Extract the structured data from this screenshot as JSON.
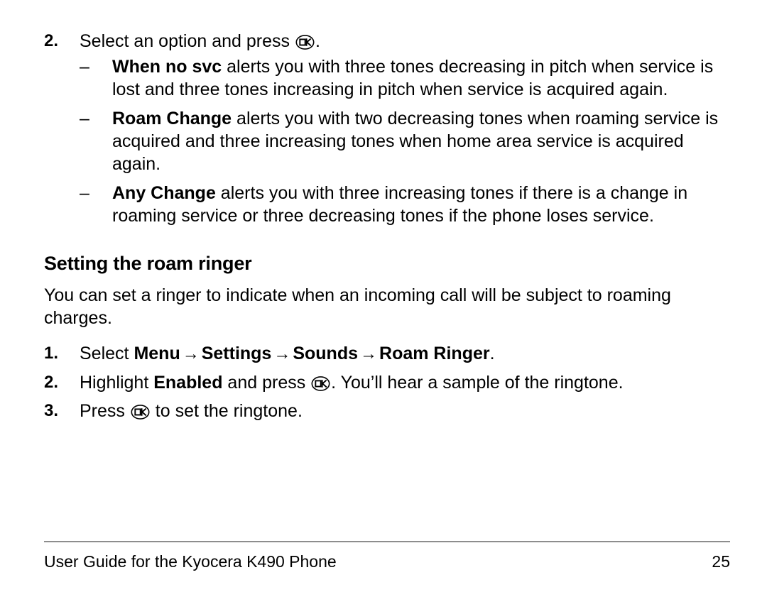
{
  "page": {
    "number": "25",
    "icons": {
      "ok_key": "ok-key-icon"
    },
    "arrow_glyph": "→"
  },
  "top_step": {
    "number": "2.",
    "text_before_icon": "Select an option and press ",
    "text_after_icon": "."
  },
  "sub_bullets": {
    "dash": "–",
    "items": [
      {
        "term": "When no svc",
        "text": " alerts you with three tones decreasing in pitch when service is lost and three tones increasing in pitch when service is acquired again."
      },
      {
        "term": "Roam Change",
        "text": " alerts you with two decreasing tones when roaming service is acquired and three increasing tones when home area service is acquired again."
      },
      {
        "term": "Any Change",
        "text": " alerts you with three increasing tones if there is a change in roaming service or three decreasing tones if the phone loses service."
      }
    ]
  },
  "section": {
    "heading": "Setting the roam ringer",
    "paragraph": "You can set a ringer to indicate when an incoming call will be subject to roaming charges."
  },
  "steps": {
    "step1": {
      "number": "1.",
      "lead": "Select ",
      "menu_path": [
        "Menu",
        "Settings",
        "Sounds",
        "Roam Ringer"
      ],
      "trailing": "."
    },
    "step2": {
      "number": "2.",
      "lead": "Highlight ",
      "bold": "Enabled",
      "mid": " and press ",
      "tail": ". You’ll hear a sample of the ringtone."
    },
    "step3": {
      "number": "3.",
      "lead": "Press ",
      "tail": " to set the ringtone."
    }
  },
  "footer": {
    "left": "User Guide for the Kyocera K490 Phone",
    "right": "25"
  }
}
